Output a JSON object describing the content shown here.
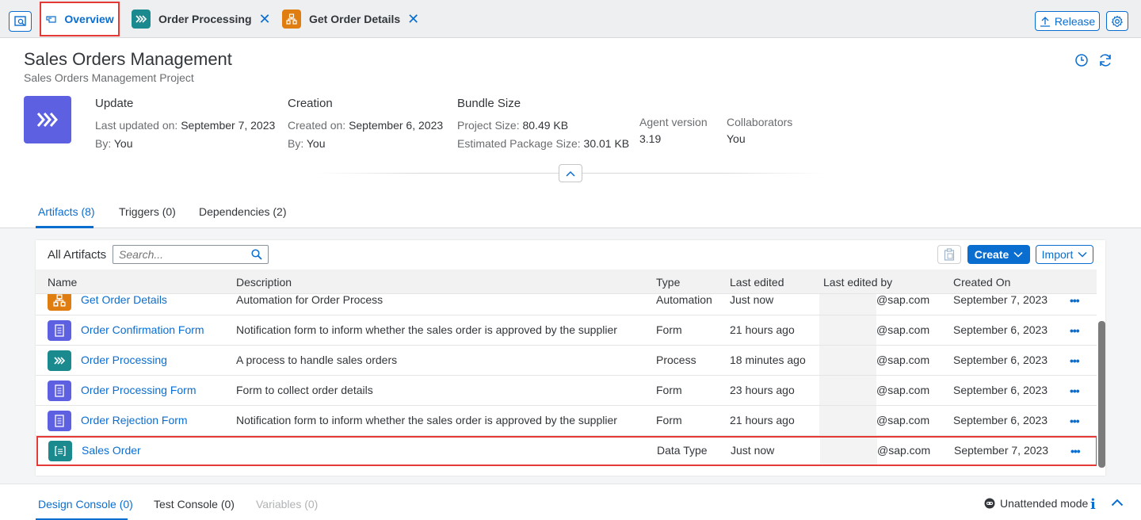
{
  "topbar": {
    "tabs": [
      {
        "label": "Overview",
        "icon": "overview-icon"
      },
      {
        "label": "Order Processing",
        "icon": "process-icon",
        "color": "#1b8a8f"
      },
      {
        "label": "Get Order Details",
        "icon": "automation-icon",
        "color": "#e07d10"
      }
    ],
    "release_label": "Release"
  },
  "header": {
    "title": "Sales Orders Management",
    "subtitle": "Sales Orders Management Project",
    "update": {
      "title": "Update",
      "last_updated_label": "Last updated on:",
      "last_updated_value": "September 7, 2023",
      "by_label": "By:",
      "by_value": "You"
    },
    "creation": {
      "title": "Creation",
      "created_label": "Created on:",
      "created_value": "September 6, 2023",
      "by_label": "By:",
      "by_value": "You"
    },
    "bundle": {
      "title": "Bundle Size",
      "project_label": "Project Size:",
      "project_value": "80.49 KB",
      "package_label": "Estimated Package Size:",
      "package_value": "30.01 KB"
    },
    "agent": {
      "label": "Agent version",
      "value": "3.19"
    },
    "collaborators": {
      "label": "Collaborators",
      "value": "You"
    }
  },
  "object_tabs": [
    {
      "label": "Artifacts (8)"
    },
    {
      "label": "Triggers (0)"
    },
    {
      "label": "Dependencies (2)"
    }
  ],
  "artifacts": {
    "title": "All Artifacts",
    "search_placeholder": "Search...",
    "create_label": "Create",
    "import_label": "Import",
    "columns": [
      "Name",
      "Description",
      "Type",
      "Last edited",
      "Last edited by",
      "Created On"
    ],
    "rows": [
      {
        "name": "Get Order Details",
        "description": "Automation for Order Process",
        "type": "Automation",
        "last_edited": "Just now",
        "edited_by": "@sap.com",
        "created_on": "September 7, 2023",
        "icon": "automation-icon",
        "color": "#e07d10"
      },
      {
        "name": "Order Confirmation Form",
        "description": "Notification form to inform whether the sales order is approved by the supplier",
        "type": "Form",
        "last_edited": "21 hours ago",
        "edited_by": "@sap.com",
        "created_on": "September 6, 2023",
        "icon": "form-icon",
        "color": "#5d60e0"
      },
      {
        "name": "Order Processing",
        "description": "A process to handle sales orders",
        "type": "Process",
        "last_edited": "18 minutes ago",
        "edited_by": "@sap.com",
        "created_on": "September 6, 2023",
        "icon": "process-icon",
        "color": "#1b8a8f"
      },
      {
        "name": "Order Processing Form",
        "description": "Form to collect order details",
        "type": "Form",
        "last_edited": "23 hours ago",
        "edited_by": "@sap.com",
        "created_on": "September 6, 2023",
        "icon": "form-icon",
        "color": "#5d60e0"
      },
      {
        "name": "Order Rejection Form",
        "description": "Notification form to inform whether the sales order is approved by the supplier",
        "type": "Form",
        "last_edited": "21 hours ago",
        "edited_by": "@sap.com",
        "created_on": "September 6, 2023",
        "icon": "form-icon",
        "color": "#5d60e0"
      },
      {
        "name": "Sales Order",
        "description": "",
        "type": "Data Type",
        "last_edited": "Just now",
        "edited_by": "@sap.com",
        "created_on": "September 7, 2023",
        "icon": "data-type-icon",
        "color": "#1b8a8f"
      }
    ]
  },
  "bottom": {
    "tabs": [
      {
        "label": "Design Console (0)"
      },
      {
        "label": "Test Console (0)"
      },
      {
        "label": "Variables (0)"
      }
    ],
    "unattended_label": "Unattended mode"
  },
  "colors": {
    "accent": "#0a6ed1",
    "highlight": "#e53935",
    "project": "#5d60e0"
  }
}
